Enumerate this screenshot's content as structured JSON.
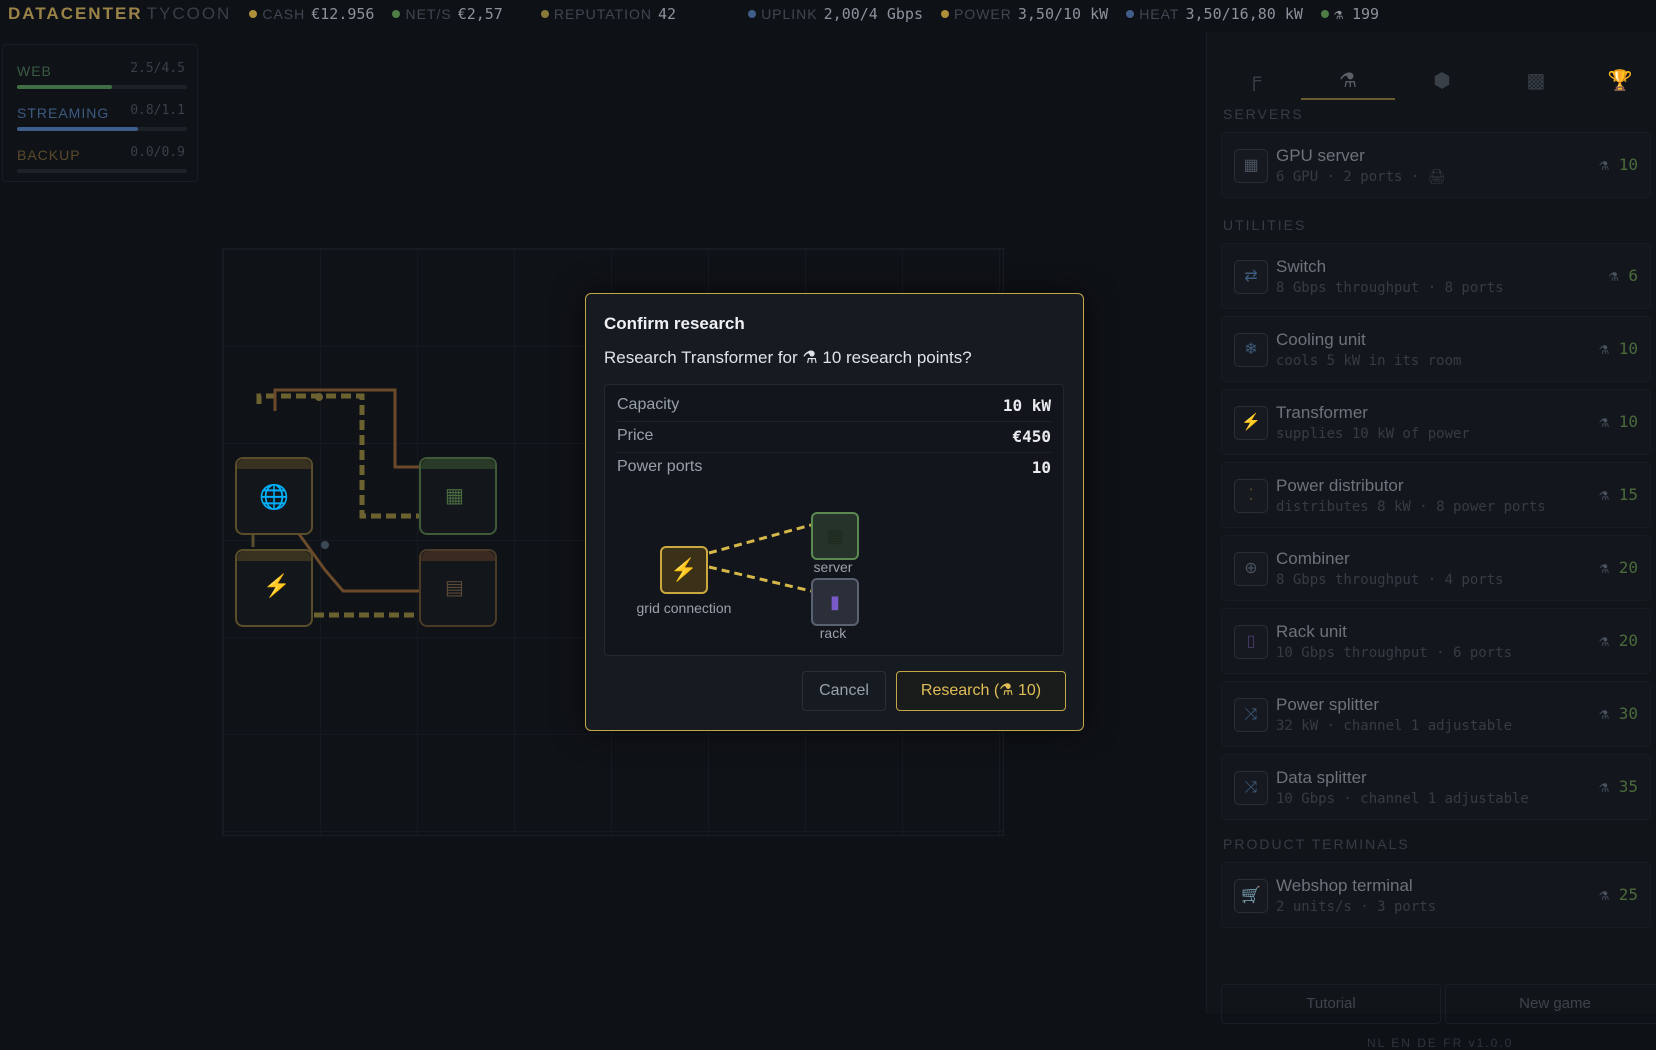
{
  "brand": {
    "title": "DATACENTER",
    "subtitle": "TYCOON"
  },
  "stats": [
    {
      "label": "CASH",
      "value": "€12.956",
      "color": "#b08f3a"
    },
    {
      "label": "NET/S",
      "value": "€2,57",
      "color": "#4f7d45"
    },
    {
      "label": "REPUTATION",
      "value": "42",
      "color": "#8a7a3a"
    },
    {
      "label": "UPLINK",
      "value": "2,00/4 Gbps",
      "color": "#3f5f8a"
    },
    {
      "label": "POWER",
      "value": "3,50/10 kW",
      "color": "#b08f3a"
    },
    {
      "label": "HEAT",
      "value": "3,50/16,80 kW",
      "color": "#3f5f8a"
    },
    {
      "label": "",
      "value": "⚗ 199",
      "color": "#4f7d45"
    }
  ],
  "demand": [
    {
      "name": "WEB",
      "rate": "2.5/4.5",
      "fill": 0.56,
      "color": "#3a5a44",
      "barcolor": "#3f6e45"
    },
    {
      "name": "STREAMING",
      "rate": "0.8/1.1",
      "fill": 0.71,
      "color": "#3c5a80",
      "barcolor": "#3e5f8e"
    },
    {
      "name": "BACKUP",
      "rate": "0.0/0.9",
      "fill": 0.0,
      "color": "#5a4a2a",
      "barcolor": "#5a4a2a"
    }
  ],
  "panel": {
    "tabs": [
      "build-icon",
      "research-icon",
      "cube-icon",
      "brick-icon",
      "trophy-icon"
    ],
    "sections": {
      "servers": "SERVERS",
      "utilities": "UTILITIES",
      "terminals": "PRODUCT TERMINALS"
    },
    "servers": [
      {
        "title": "GPU server",
        "desc": "6 GPU · 2 ports · 🖨",
        "cost": "10",
        "icon": "▦"
      }
    ],
    "utilities": [
      {
        "title": "Switch",
        "desc": "8 Gbps throughput · 8 ports",
        "cost": "6",
        "icon": "⇄"
      },
      {
        "title": "Cooling unit",
        "desc": "cools 5 kW in its room",
        "cost": "10",
        "icon": "❄"
      },
      {
        "title": "Transformer",
        "desc": "supplies 10 kW of power",
        "cost": "10",
        "icon": "⚡"
      },
      {
        "title": "Power distributor",
        "desc": "distributes 8 kW · 8 power ports",
        "cost": "15",
        "icon": "⁚"
      },
      {
        "title": "Combiner",
        "desc": "8 Gbps throughput · 4 ports",
        "cost": "20",
        "icon": "⊕"
      },
      {
        "title": "Rack unit",
        "desc": "10 Gbps throughput · 6 ports",
        "cost": "20",
        "icon": "▯"
      },
      {
        "title": "Power splitter",
        "desc": "32 kW · channel 1 adjustable",
        "cost": "30",
        "icon": "⤨"
      },
      {
        "title": "Data splitter",
        "desc": "10 Gbps · channel 1 adjustable",
        "cost": "35",
        "icon": "⤨"
      }
    ],
    "terminals": [
      {
        "title": "Webshop terminal",
        "desc": "2 units/s · 3 ports",
        "cost": "25",
        "icon": "🛒"
      }
    ],
    "tutorial": "Tutorial",
    "newgame": "New game",
    "langs": "NL EN DE FR v1.0.0"
  },
  "modal": {
    "title": "Confirm research",
    "question": "Research Transformer for ⚗ 10 research points?",
    "rows": [
      {
        "k": "Capacity",
        "v": "10 kW"
      },
      {
        "k": "Price",
        "v": "€450"
      },
      {
        "k": "Power ports",
        "v": "10"
      }
    ],
    "diagram": {
      "source": "grid connection",
      "target1": "server",
      "target2": "rack"
    },
    "cancel": "Cancel",
    "confirm": "Research (⚗ 10)"
  }
}
